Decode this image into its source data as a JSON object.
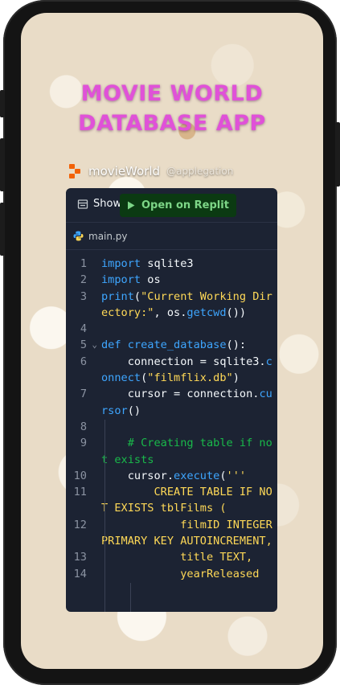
{
  "app": {
    "title_line1": "MOVIE WORLD",
    "title_line2": "DATABASE APP",
    "author_name": "movieWorld",
    "author_handle": "@applegation"
  },
  "embed": {
    "show_label": "Show",
    "open_label": "Open on Replit",
    "file_name": "main.py",
    "lines": [
      {
        "n": "1",
        "text": "import sqlite3"
      },
      {
        "n": "2",
        "text": "import os"
      },
      {
        "n": "3",
        "text": "print(\"Current Working Directory:\", os.getcwd())"
      },
      {
        "n": "4",
        "text": ""
      },
      {
        "n": "5",
        "text": "def create_database():"
      },
      {
        "n": "6",
        "text": "    connection = sqlite3.connect(\"filmflix.db\")"
      },
      {
        "n": "7",
        "text": "    cursor = connection.cursor()"
      },
      {
        "n": "8",
        "text": ""
      },
      {
        "n": "9",
        "text": "    # Creating table if not exists"
      },
      {
        "n": "10",
        "text": "    cursor.execute('''"
      },
      {
        "n": "11",
        "text": "        CREATE TABLE IF NOT EXISTS tblFilms ("
      },
      {
        "n": "12",
        "text": "            filmID INTEGER PRIMARY KEY AUTOINCREMENT,"
      },
      {
        "n": "13",
        "text": "            title TEXT,"
      },
      {
        "n": "14",
        "text": "            yearReleased"
      }
    ]
  },
  "colors": {
    "title": "#e051d8",
    "embed_bg": "#1c2333",
    "keyword": "#3ea6ff",
    "string": "#ffd957",
    "comment": "#19b94a",
    "run_button_bg": "#0b3a12",
    "run_button_text": "#7dd687"
  },
  "icons": {
    "show": "files-icon",
    "open": "play-icon",
    "file": "python-icon",
    "fold": "chevron-down-icon"
  }
}
